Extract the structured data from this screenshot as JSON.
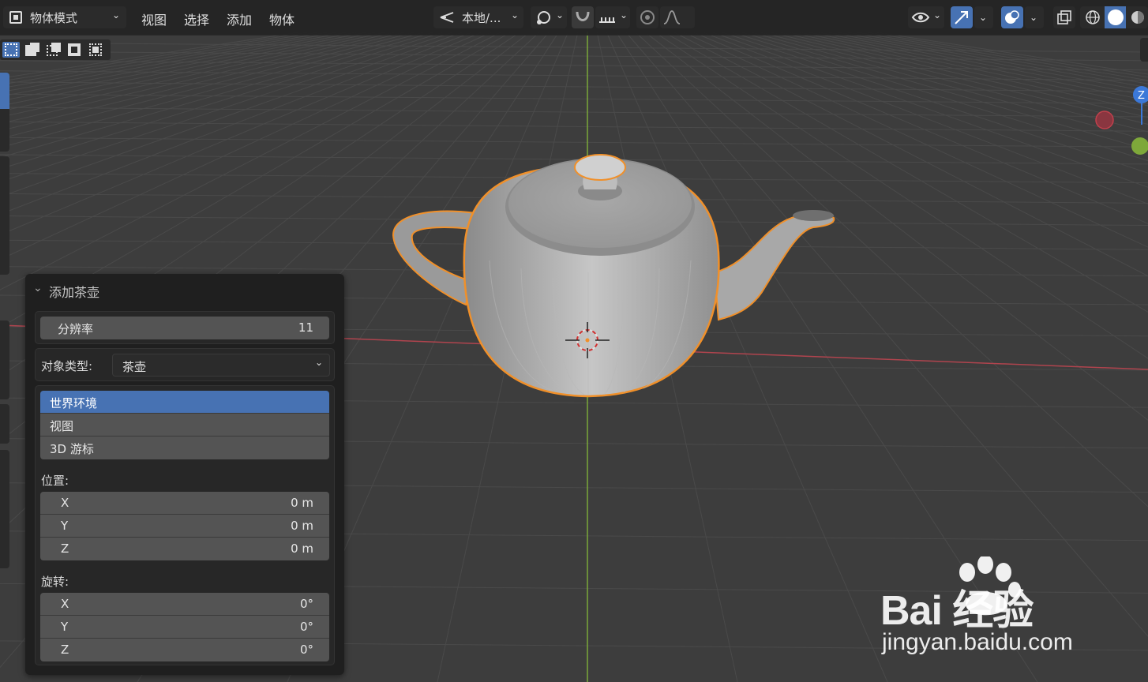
{
  "header": {
    "mode_label": "物体模式",
    "menus": [
      "视图",
      "选择",
      "添加",
      "物体"
    ],
    "orientation_label": "本地/..."
  },
  "gizmo": {
    "z_label": "Z"
  },
  "operator_panel": {
    "title": "添加茶壶",
    "resolution": {
      "label": "分辨率",
      "value": "11"
    },
    "object_type": {
      "label": "对象类型:",
      "value": "茶壶"
    },
    "align_options": [
      "世界环境",
      "视图",
      "3D 游标"
    ],
    "align_selected": "世界环境",
    "location": {
      "label": "位置:",
      "x": {
        "label": "X",
        "value": "0 m"
      },
      "y": {
        "label": "Y",
        "value": "0 m"
      },
      "z": {
        "label": "Z",
        "value": "0 m"
      }
    },
    "rotation": {
      "label": "旋转:",
      "x": {
        "label": "X",
        "value": "0°"
      },
      "y": {
        "label": "Y",
        "value": "0°"
      },
      "z": {
        "label": "Z",
        "value": "0°"
      }
    }
  },
  "watermark": {
    "brand": "Bai 经验",
    "url": "jingyan.baidu.com"
  },
  "colors": {
    "accent": "#4772b3",
    "selection_outline": "#f0902a",
    "axis_x": "#c0404c",
    "axis_y": "#7ea83a"
  }
}
